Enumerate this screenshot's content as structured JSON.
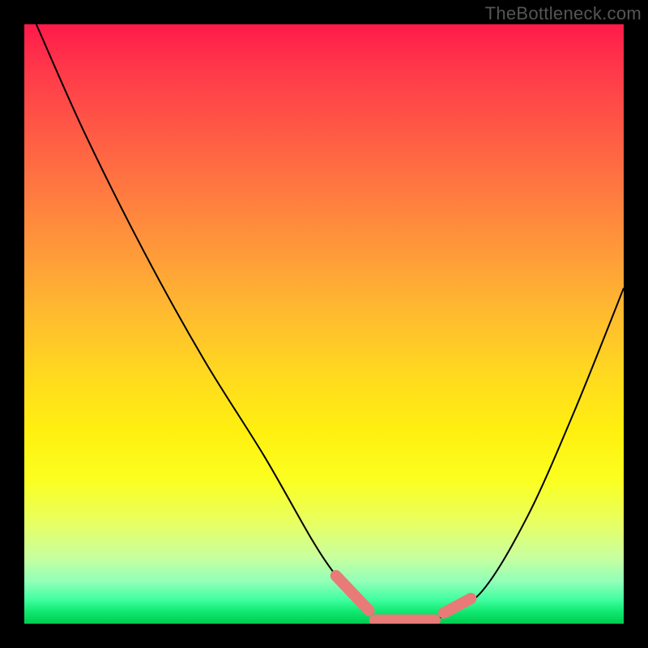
{
  "watermark": "TheBottleneck.com",
  "colors": {
    "background": "#000000",
    "curve": "#000000",
    "marker": "#e87a78",
    "grad_top": "#ff1a4a",
    "grad_mid": "#fff010",
    "grad_bottom": "#00cc50"
  },
  "chart_data": {
    "type": "line",
    "title": "",
    "xlabel": "",
    "ylabel": "",
    "xlim": [
      0,
      100
    ],
    "ylim": [
      0,
      100
    ],
    "grid": false,
    "legend": "none",
    "note": "Axes are unlabeled; values are read as percent of plot width/height. The curve is a V-shaped function with a flat minimum region highlighted.",
    "series": [
      {
        "name": "curve",
        "x": [
          2,
          10,
          20,
          30,
          40,
          48,
          52,
          56,
          60,
          64,
          68,
          76,
          84,
          92,
          100
        ],
        "y": [
          100,
          82,
          62,
          44,
          28,
          14,
          8,
          3,
          0.5,
          0,
          0.5,
          5,
          18,
          36,
          56
        ]
      }
    ],
    "flat_minimum": {
      "x_start": 60,
      "x_end": 68,
      "y": 0
    },
    "highlight_segments": [
      {
        "x": [
          52,
          57.5
        ],
        "y": [
          8,
          2.2
        ]
      },
      {
        "x": [
          58.5,
          68.5
        ],
        "y": [
          0.6,
          0.6
        ]
      },
      {
        "x": [
          70,
          74.5
        ],
        "y": [
          1.8,
          4.2
        ]
      }
    ]
  }
}
